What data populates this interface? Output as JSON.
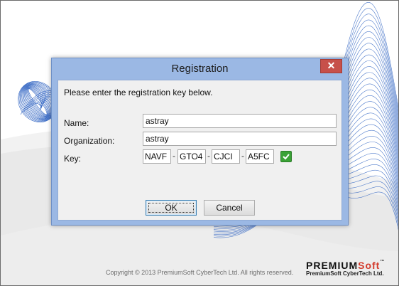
{
  "splash": {
    "copyright": "Copyright © 2013 PremiumSoft CyberTech Ltd. All rights reserved.",
    "brand_premium": "PremiumSoft",
    "brand_tm": "™",
    "brand_sub": "PremiumSoft CyberTech Ltd."
  },
  "dialog": {
    "title": "Registration",
    "close_glyph": "✕",
    "prompt": "Please enter the registration key below.",
    "name_label": "Name:",
    "name_value": "astray",
    "organization_label": "Organization:",
    "organization_value": "astray",
    "key_label": "Key:",
    "key_parts": [
      "NAVF",
      "GTO4",
      "CJCI",
      "A5FC"
    ],
    "key_separator": "-",
    "ok_label": "OK",
    "cancel_label": "Cancel"
  },
  "colors": {
    "titlebar": "#9bb8e4",
    "close_button": "#c7504a",
    "brand_accent": "#d33b2c",
    "valid_check": "#3aa236",
    "wave_lines": "#2f63c2"
  }
}
